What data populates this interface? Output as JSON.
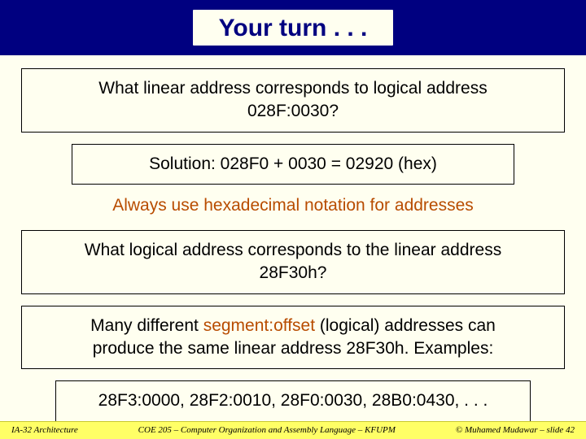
{
  "title": "Your turn . . .",
  "box1": {
    "line1": "What linear address corresponds to logical address",
    "line2": "028F:0030?"
  },
  "box2": "Solution: 028F0 + 0030 = 02920 (hex)",
  "emph": "Always use hexadecimal notation for addresses",
  "box3": {
    "line1": "What logical address corresponds to the linear address",
    "line2": "28F30h?"
  },
  "box4": {
    "part1": "Many different ",
    "segoff": "segment:offset",
    "part2": " (logical) addresses can",
    "line2": "produce the same linear address 28F30h. Examples:"
  },
  "box5": "28F3:0000, 28F2:0010, 28F0:0030, 28B0:0430, . . .",
  "footer": {
    "left": "IA-32 Architecture",
    "center": "COE 205 – Computer Organization and Assembly Language – KFUPM",
    "right": "© Muhamed Mudawar – slide 42"
  }
}
